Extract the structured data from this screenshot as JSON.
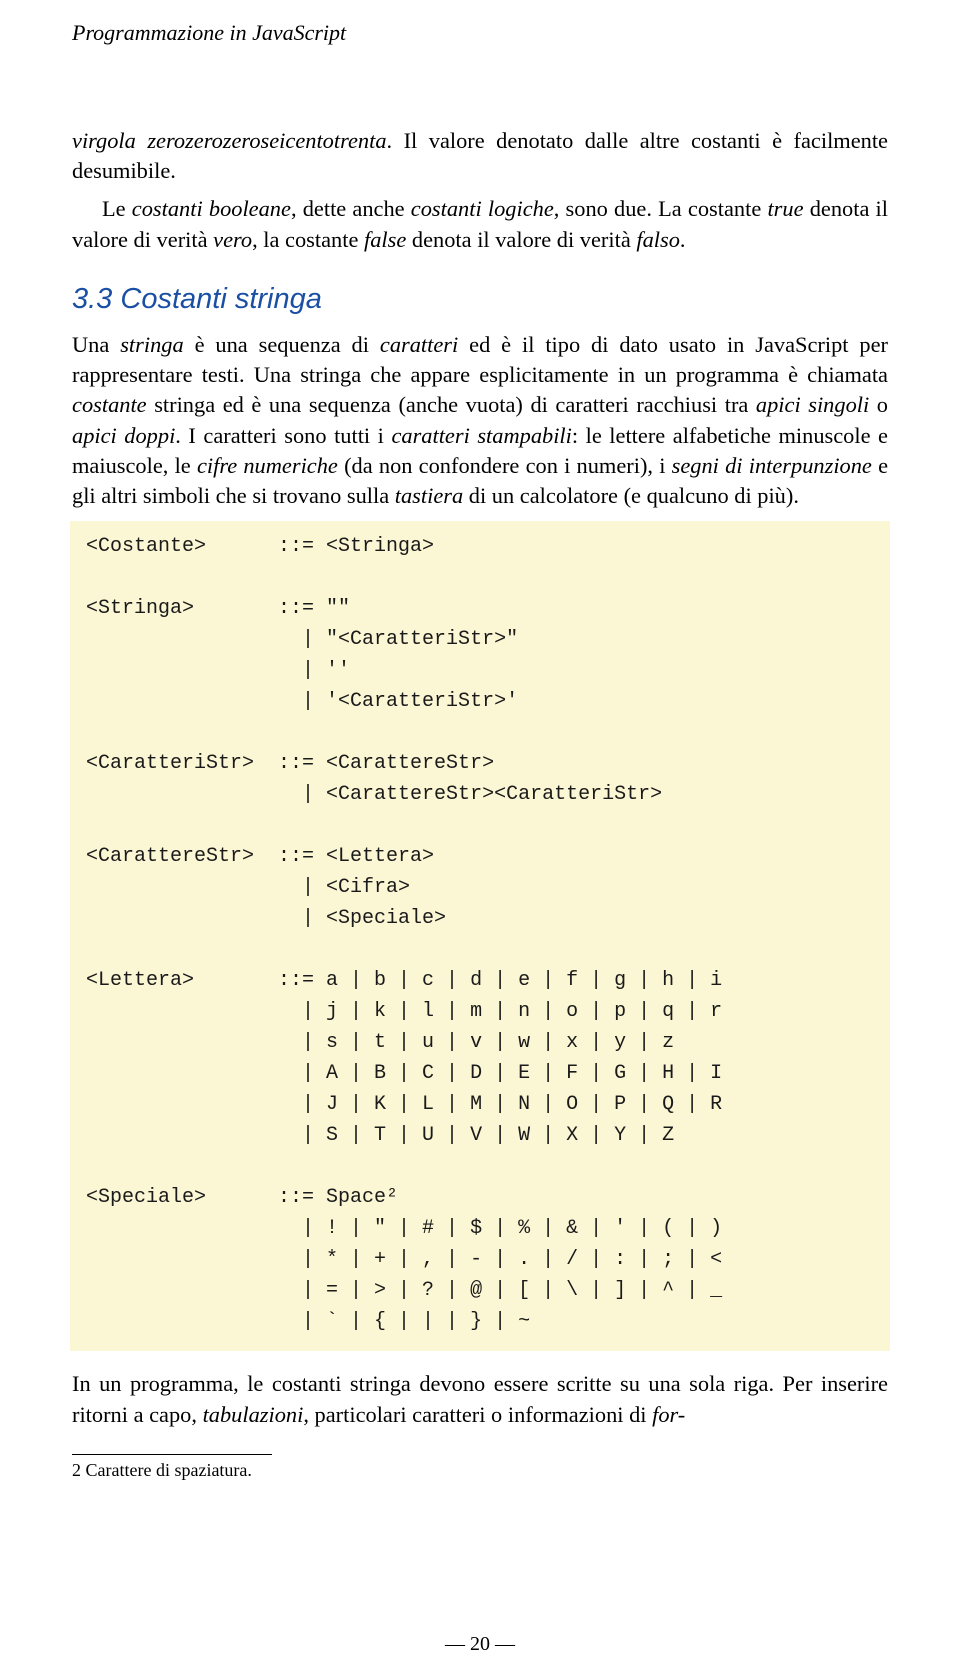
{
  "running_head": "Programmazione in JavaScript",
  "p1_a": "virgola zerozerozeroseicentotrenta",
  "p1_b": ". Il valore denotato dalle altre costanti è fa­cilmente desumibile.",
  "p2_a": "Le ",
  "p2_b": "costanti booleane",
  "p2_c": ", dette anche ",
  "p2_d": "costanti logiche",
  "p2_e": ", sono due. La costante ",
  "p2_f": "true",
  "p2_g": " denota il valore di verità ",
  "p2_h": "vero",
  "p2_i": ", la costante ",
  "p2_j": "false",
  "p2_k": " denota il valore di verità ",
  "p2_l": "falso",
  "p2_m": ".",
  "section": "3.3  Costanti stringa",
  "p3_a": "Una ",
  "p3_b": "stringa",
  "p3_c": " è una sequenza di ",
  "p3_d": "caratteri",
  "p3_e": " ed è il tipo di dato usato in JavaScript per rappresentare testi. Una stringa che appare esplicitamente in un program­ma è chiamata ",
  "p3_f": "costante",
  "p3_g": " stringa ed è una sequenza (anche vuota) di caratteri rac­chiusi tra ",
  "p3_h": "apici singoli",
  "p3_i": " o ",
  "p3_j": "apici doppi",
  "p3_k": ". I caratteri sono tutti i ",
  "p3_l": "caratteri stampabili",
  "p3_m": ": le lettere alfabetiche minuscole e maiuscole, le ",
  "p3_n": "cifre numeriche",
  "p3_o": " (da non confon­dere con i numeri), i ",
  "p3_p": "segni di interpunzione",
  "p3_q": " e gli altri simboli che si trovano sul­la ",
  "p3_r": "tastiera",
  "p3_s": " di un calcolatore (e qualcuno di più).",
  "grammar": "<Costante>      ::= <Stringa>\n\n<Stringa>       ::= \"\"\n                  | \"<CaratteriStr>\"\n                  | ''\n                  | '<CaratteriStr>'\n\n<CaratteriStr>  ::= <CarattereStr>\n                  | <CarattereStr><CaratteriStr>\n\n<CarattereStr>  ::= <Lettera>\n                  | <Cifra>\n                  | <Speciale>\n\n<Lettera>       ::= a | b | c | d | e | f | g | h | i\n                  | j | k | l | m | n | o | p | q | r\n                  | s | t | u | v | w | x | y | z\n                  | A | B | C | D | E | F | G | H | I\n                  | J | K | L | M | N | O | P | Q | R\n                  | S | T | U | V | W | X | Y | Z\n\n<Speciale>      ::= Space²\n                  | ! | \" | # | $ | % | & | ' | ( | )\n                  | * | + | , | - | . | / | : | ; | <\n                  | = | > | ? | @ | [ | \\ | ] | ^ | _\n                  | ` | { | | | } | ~",
  "p4_a": "In un programma, le costanti stringa devono essere scritte su una sola riga. Per inserire ritorni a capo, ",
  "p4_b": "tabulazioni",
  "p4_c": ", particolari caratteri o informazioni di ",
  "p4_d": "for-",
  "footnote": "2  Carattere di spaziatura.",
  "pagenum": "—  20  —"
}
